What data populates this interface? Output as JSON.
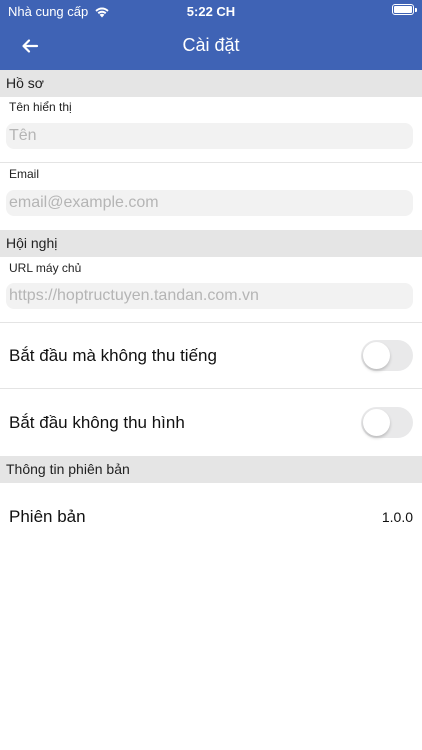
{
  "status_bar": {
    "carrier": "Nhà cung cấp",
    "time": "5:22 CH"
  },
  "navbar": {
    "title": "Cài đặt",
    "back_icon": "arrow-left-icon"
  },
  "profile": {
    "header": "Hồ sơ",
    "display_name_label": "Tên hiển thị",
    "display_name_placeholder": "Tên",
    "email_label": "Email",
    "email_placeholder": "email@example.com"
  },
  "conference": {
    "header": "Hội nghị",
    "server_url_label": "URL máy chủ",
    "server_url_placeholder": "https://hoptructuyen.tandan.com.vn",
    "start_audio_muted_label": "Bắt đầu mà không thu tiếng",
    "start_audio_muted": false,
    "start_video_muted_label": "Bắt đầu không thu hình",
    "start_video_muted": false
  },
  "version_info": {
    "header": "Thông tin phiên bản",
    "version_label": "Phiên bản",
    "version_value": "1.0.0"
  },
  "colors": {
    "accent": "#3f63b5",
    "section_bg": "#e5e5e5",
    "input_bg": "#f2f2f2",
    "toggle_off": "#e9e9ea"
  }
}
